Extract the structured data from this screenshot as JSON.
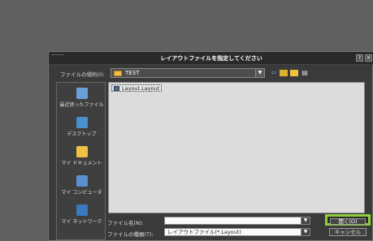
{
  "dialog": {
    "title": "レイアウトファイルを指定してください"
  },
  "lookin": {
    "label": "ファイルの場所(I):",
    "value": "TEST"
  },
  "places": [
    {
      "label": "最近使ったファイル",
      "icon": "recent-files-icon"
    },
    {
      "label": "デスクトップ",
      "icon": "desktop-icon"
    },
    {
      "label": "マイ ドキュメント",
      "icon": "my-documents-icon"
    },
    {
      "label": "マイ コンピュータ",
      "icon": "my-computer-icon"
    },
    {
      "label": "マイ ネットワーク",
      "icon": "my-network-icon"
    }
  ],
  "files": [
    {
      "name": "Layout.Layout",
      "icon": "layout-file-icon"
    }
  ],
  "filename": {
    "label": "ファイル名(N):",
    "value": ""
  },
  "filetype": {
    "label": "ファイルの種類(T):",
    "value": "レイアウトファイル(*.Layout)"
  },
  "buttons": {
    "open": "開く(O)",
    "cancel": "キャンセル"
  },
  "colors": {
    "highlight": "#8fcf3a"
  }
}
